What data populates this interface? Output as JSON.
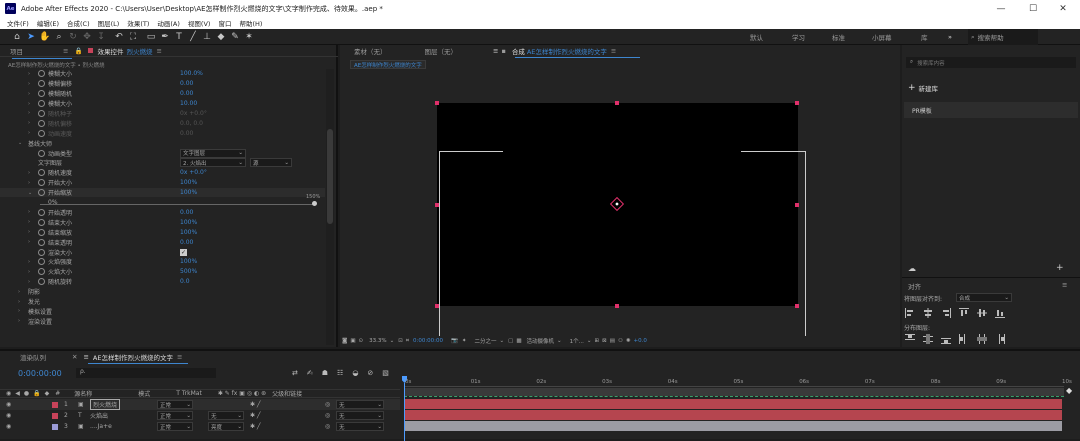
{
  "app": {
    "title": "Adobe After Effects 2020 - C:\\Users\\User\\Desktop\\AE怎样制作烈火燃烧的文字\\文字制作完成、待效果。.aep *",
    "logo": "Ae"
  },
  "window_controls": [
    "—",
    "☐",
    "✕"
  ],
  "menu": [
    "文件(F)",
    "编辑(E)",
    "合成(C)",
    "图层(L)",
    "效果(T)",
    "动画(A)",
    "视图(V)",
    "窗口",
    "帮助(H)"
  ],
  "workspaces": [
    "默认",
    "学习",
    "标准",
    "小屏幕",
    "库"
  ],
  "search_help": "搜索帮助",
  "left_panel": {
    "tab_project": "项目",
    "tab_effects_prefix": "效果控件",
    "tab_effects_layer": "烈火燃烧",
    "breadcrumb": "AE怎样制作烈火燃烧的文字 • 烈火燃烧",
    "rows": [
      {
        "indent": 2,
        "tri": "›",
        "sw": true,
        "label": "模糊大小",
        "value": "100.0%",
        "dim": false
      },
      {
        "indent": 2,
        "tri": "›",
        "sw": true,
        "label": "模糊偏移",
        "value": "0.00",
        "dim": false
      },
      {
        "indent": 2,
        "tri": "›",
        "sw": true,
        "label": "模糊随机",
        "value": "0.00",
        "dim": false
      },
      {
        "indent": 2,
        "tri": "›",
        "sw": true,
        "label": "模糊大小",
        "value": "10.00",
        "dim": false
      },
      {
        "indent": 2,
        "tri": "›",
        "sw": true,
        "label": "随机种子",
        "value": "0x +0.0°",
        "dim": true
      },
      {
        "indent": 2,
        "tri": "›",
        "sw": true,
        "label": "随机偏移",
        "value": "0.0, 0.0",
        "dim": true
      },
      {
        "indent": 2,
        "tri": "›",
        "sw": true,
        "label": "动画速度",
        "value": "0.00",
        "dim": true
      },
      {
        "indent": 1,
        "tri": "⌄",
        "sw": false,
        "label": "基线大师",
        "value": "",
        "dim": false
      },
      {
        "indent": 2,
        "tri": "",
        "sw": true,
        "label": "动画类型",
        "value": "文字图层",
        "dim": false,
        "dropdown": true
      },
      {
        "indent": 2,
        "tri": "",
        "sw": false,
        "label": "文字图层",
        "value": "2. 火焰出",
        "dim": false,
        "dropdown": true,
        "value2": "源"
      },
      {
        "indent": 2,
        "tri": "›",
        "sw": true,
        "label": "随机速度",
        "value": "0x +0.0°",
        "dim": false
      },
      {
        "indent": 2,
        "tri": "›",
        "sw": true,
        "label": "开始大小",
        "value": "100%",
        "dim": false
      },
      {
        "indent": 2,
        "tri": "⌄",
        "sw": true,
        "label": "开始缩放",
        "value": "100%",
        "dim": false
      },
      {
        "indent": 3,
        "tri": "",
        "sw": false,
        "label": "0%",
        "value": "",
        "dim": false,
        "slider": true
      },
      {
        "indent": 2,
        "tri": "›",
        "sw": true,
        "label": "开始透明",
        "value": "0.00",
        "dim": false
      },
      {
        "indent": 2,
        "tri": "›",
        "sw": true,
        "label": "结束大小",
        "value": "100%",
        "dim": false
      },
      {
        "indent": 2,
        "tri": "›",
        "sw": true,
        "label": "结束缩放",
        "value": "100%",
        "dim": false
      },
      {
        "indent": 2,
        "tri": "›",
        "sw": true,
        "label": "结束透明",
        "value": "0.00",
        "dim": false
      },
      {
        "indent": 2,
        "tri": "",
        "sw": true,
        "label": "渲染大小",
        "value": "",
        "dim": false,
        "checkbox": true
      },
      {
        "indent": 2,
        "tri": "›",
        "sw": true,
        "label": "火焰强度",
        "value": "100%",
        "dim": false
      },
      {
        "indent": 2,
        "tri": "›",
        "sw": true,
        "label": "火焰大小",
        "value": "500%",
        "dim": false
      },
      {
        "indent": 2,
        "tri": "›",
        "sw": true,
        "label": "随机旋转",
        "value": "0.0",
        "dim": false
      },
      {
        "indent": 1,
        "tri": "›",
        "sw": false,
        "label": "阴影",
        "value": "",
        "dim": false
      },
      {
        "indent": 1,
        "tri": "›",
        "sw": false,
        "label": "发光",
        "value": "",
        "dim": false
      },
      {
        "indent": 1,
        "tri": "›",
        "sw": false,
        "label": "模拟设置",
        "value": "",
        "dim": false
      },
      {
        "indent": 1,
        "tri": "›",
        "sw": false,
        "label": "渲染设置",
        "value": "",
        "dim": false
      }
    ],
    "slider_max": "150%"
  },
  "comp_panel": {
    "tab_footage": "素材（无）",
    "tab_layer": "图层（无）",
    "tab_comp_prefix": "合成",
    "tab_comp_name": "AE怎样制作烈火燃烧的文字",
    "sub_tab": "AE怎样制作烈火燃烧的文字",
    "zoom": "33.3%",
    "timecode": "0:00:00:00",
    "resolution": "二分之一",
    "camera": "活动摄像机",
    "views": "1个...",
    "exposure": "+0.0"
  },
  "right_panel": {
    "search_placeholder": "搜索库内容",
    "new_library": "新建库",
    "library_item": "PR模板",
    "align_title": "对齐",
    "align_to_label": "将图层对齐到:",
    "align_to_value": "合成",
    "distribute_label": "分布图层:"
  },
  "timeline": {
    "tab_render": "渲染队列",
    "tab_comp": "AE怎样制作烈火燃烧的文字",
    "timecode": "0:00:00:00",
    "search_placeholder": "ρ.",
    "headers": {
      "source": "源名称",
      "mode": "模式",
      "trkmat": "T TrkMat",
      "parent": "父级和链接"
    },
    "layers": [
      {
        "num": "1",
        "name": "烈火燃烧",
        "mode": "正常",
        "trkmat": "",
        "parent": "无",
        "color": "#c8435a",
        "selected": true
      },
      {
        "num": "2",
        "name": "火焰出",
        "mode": "正常",
        "trkmat": "无",
        "parent": "无",
        "color": "#c8435a",
        "selected": false
      },
      {
        "num": "3",
        "name": "....Ja+e",
        "mode": "正常",
        "trkmat": "亮度",
        "parent": "无",
        "color": "#9a9ad6",
        "selected": false
      }
    ],
    "ruler": [
      "0s",
      "01s",
      "02s",
      "03s",
      "04s",
      "05s",
      "06s",
      "07s",
      "08s",
      "09s",
      "10s"
    ]
  },
  "colors": {
    "accent": "#4c9bff",
    "layer_bar_red": "#b5454f",
    "layer_bar_gray": "#9c9ca4",
    "handle": "#e0306a"
  }
}
